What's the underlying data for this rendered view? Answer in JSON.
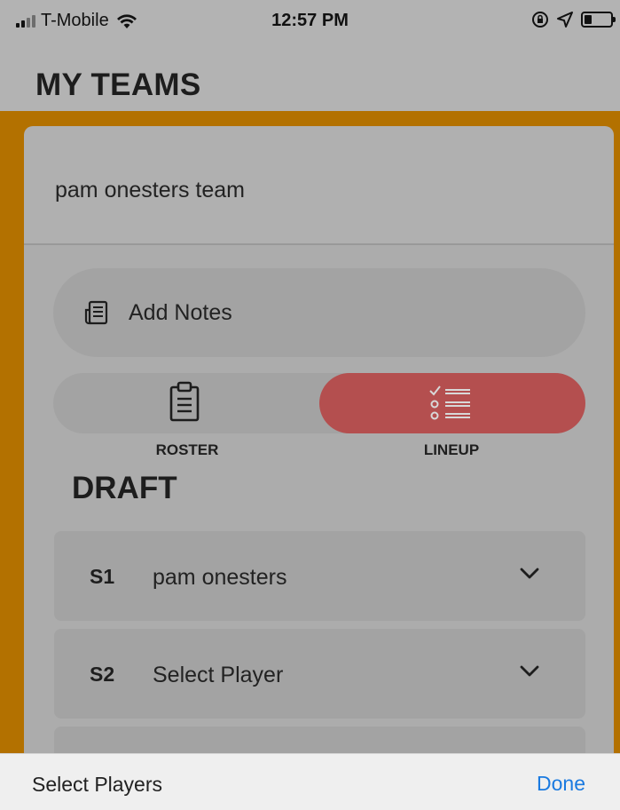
{
  "status_bar": {
    "carrier": "T-Mobile",
    "time": "12:57 PM"
  },
  "header": {
    "title": "MY TEAMS"
  },
  "team": {
    "name": "pam onesters team"
  },
  "notes": {
    "label": "Add Notes",
    "icon": "notes-icon"
  },
  "view_toggle": {
    "roster_label": "ROSTER",
    "lineup_label": "LINEUP",
    "selected": "LINEUP",
    "selected_color": "#b44f4f"
  },
  "section": {
    "title": "DRAFT"
  },
  "lineup": [
    {
      "code": "S1",
      "player": "pam onesters"
    },
    {
      "code": "S2",
      "player": "Select Player"
    },
    {
      "code": "",
      "player": ""
    }
  ],
  "picker": {
    "title": "Select Players",
    "done_label": "Done",
    "done_color": "#1a7ae0"
  },
  "colors": {
    "accent_band": "#b37100",
    "overlay_gray": "#b3b3b3"
  }
}
